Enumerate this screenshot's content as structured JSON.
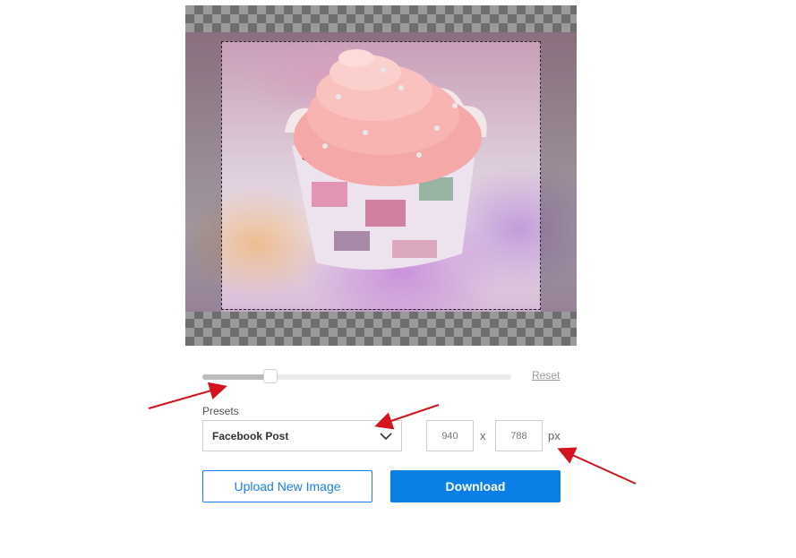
{
  "editor": {
    "canvas_pattern": "transparency-checkerboard",
    "image_subject": "pink-cupcake-photo"
  },
  "zoom_slider": {
    "value_fraction": 0.22,
    "reset_label": "Reset"
  },
  "presets": {
    "label": "Presets",
    "selected": "Facebook Post",
    "width_placeholder": "940",
    "height_placeholder": "788",
    "times_symbol": "x",
    "unit": "px"
  },
  "buttons": {
    "upload_label": "Upload New Image",
    "download_label": "Download"
  },
  "colors": {
    "accent": "#0a7fe6",
    "annotation_arrow": "#d4141c"
  },
  "icons": {
    "dropdown": "chevron-down-icon"
  }
}
